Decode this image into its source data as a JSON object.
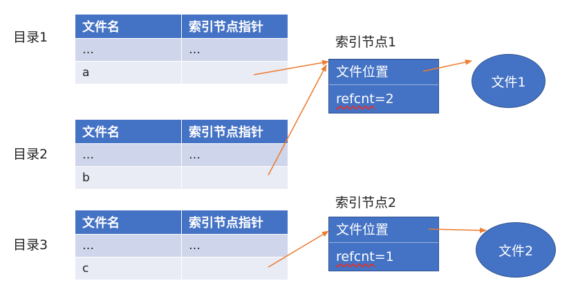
{
  "table_headers": {
    "name": "文件名",
    "pointer": "索引节点指针"
  },
  "directories": [
    {
      "label": "目录1",
      "rows": [
        {
          "name": "…",
          "pointer": "…"
        },
        {
          "name": "a",
          "pointer": ""
        }
      ]
    },
    {
      "label": "目录2",
      "rows": [
        {
          "name": "…",
          "pointer": "…"
        },
        {
          "name": "b",
          "pointer": ""
        }
      ]
    },
    {
      "label": "目录3",
      "rows": [
        {
          "name": "…",
          "pointer": "…"
        },
        {
          "name": "c",
          "pointer": ""
        }
      ]
    }
  ],
  "inodes": [
    {
      "title": "索引节点1",
      "location": "文件位置",
      "refcnt_key": "refcnt",
      "refcnt_value": "=2"
    },
    {
      "title": "索引节点2",
      "location": "文件位置",
      "refcnt_key": "refcnt",
      "refcnt_value": "=1"
    }
  ],
  "files": [
    "文件1",
    "文件2"
  ],
  "colors": {
    "header_blue": "#4472C4",
    "row_dark": "#CFD5EA",
    "row_light": "#E9EBF5",
    "arrow": "#ED7D31"
  }
}
